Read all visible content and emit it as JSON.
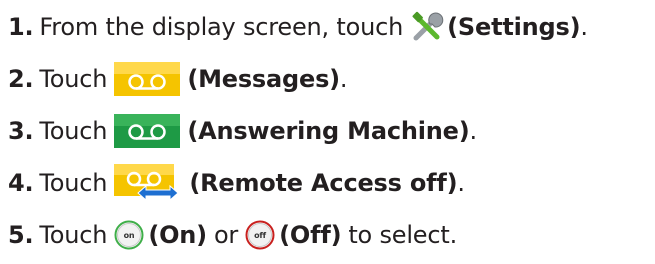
{
  "steps": [
    {
      "number": "1.",
      "before": "From the display screen, touch",
      "icon": "settings-wrench-icon",
      "label": "(Settings)",
      "after": "."
    },
    {
      "number": "2.",
      "before": "Touch",
      "icon": "messages-voicemail-icon",
      "label": "(Messages)",
      "after": "."
    },
    {
      "number": "3.",
      "before": "Touch",
      "icon": "answering-machine-icon",
      "label": "(Answering Machine)",
      "after": "."
    },
    {
      "number": "4.",
      "before": "Touch",
      "icon": "remote-access-off-icon",
      "label": "(Remote Access off)",
      "after": "."
    },
    {
      "number": "5.",
      "before": "Touch",
      "on_icon_text": "on",
      "on_label": "(On)",
      "or": "or",
      "off_icon_text": "off",
      "off_label": "(Off)",
      "after": "to select."
    }
  ],
  "colors": {
    "text": "#231f20",
    "messages_icon": "#f5c400",
    "answering_machine_icon": "#1e9a45",
    "remote_access_arrow": "#1e6fd1",
    "on_ring": "#3fae49",
    "off_ring": "#c8201e"
  }
}
